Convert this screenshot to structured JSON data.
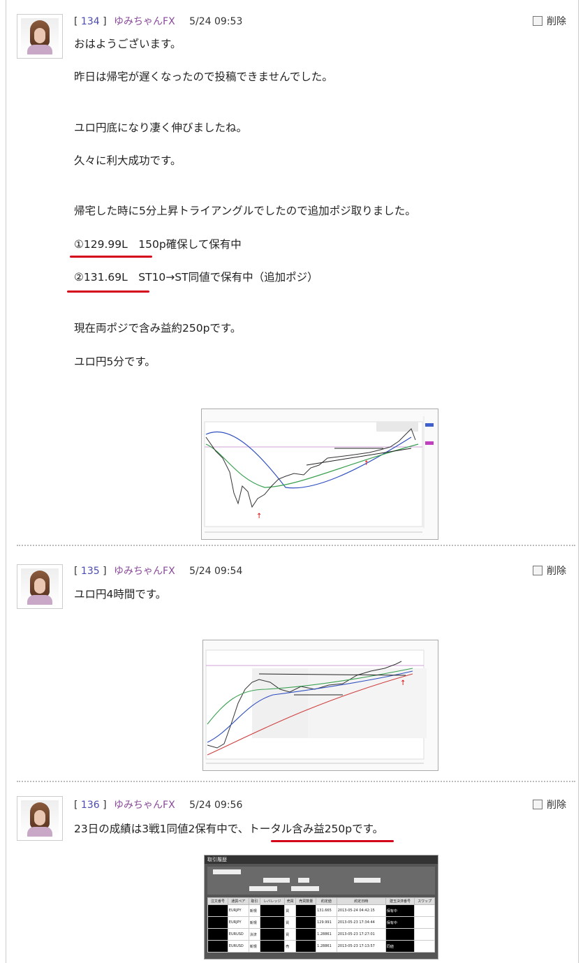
{
  "posts": [
    {
      "number": "134",
      "user": "ゆみちゃんFX",
      "date": "5/24 09:53",
      "delete_label": "削除",
      "lines": [
        "おはようございます。",
        "昨日は帰宅が遅くなったので投稿できませんでした。",
        "ユロ円底になり凄く伸びましたね。",
        "久々に利大成功です。",
        "帰宅した時に5分上昇トライアングルでしたので追加ポジ取りました。",
        "①129.99L　150p確保して保有中",
        "②131.69L　ST10→ST同値で保有中（追加ポジ）",
        "現在両ポジで含み益約250pです。",
        "ユロ円5分です。"
      ]
    },
    {
      "number": "135",
      "user": "ゆみちゃんFX",
      "date": "5/24 09:54",
      "delete_label": "削除",
      "lines": [
        "ユロ円4時間です。"
      ]
    },
    {
      "number": "136",
      "user": "ゆみちゃんFX",
      "date": "5/24 09:56",
      "delete_label": "削除",
      "lines": [
        "23日の成績は3戦1同値2保有中で、トータル含み益250pです。"
      ]
    }
  ],
  "history_table": {
    "title": "取引履歴",
    "headers": [
      "注文番号",
      "通貨ペア",
      "取引",
      "レバレッジ",
      "売買",
      "売買数量",
      "約定値",
      "約定日時",
      "建玉決済番号",
      "スワップ"
    ],
    "rows": [
      [
        "",
        "EURJPY",
        "新規",
        "",
        "買",
        "",
        "131.665",
        "2013-05-24 04:42:15",
        "保有中",
        ""
      ],
      [
        "",
        "EURJPY",
        "新規",
        "",
        "買",
        "",
        "129.991",
        "2013-05-23 17:34:44",
        "保有中",
        ""
      ],
      [
        "",
        "EURUSD",
        "決済",
        "",
        "買",
        "",
        "1.28861",
        "2013-05-23 17:27:01",
        "",
        ""
      ],
      [
        "",
        "EURUSD",
        "新規",
        "",
        "売",
        "",
        "1.28861",
        "2013-05-23 17:13:57",
        "同値",
        ""
      ]
    ]
  },
  "colors": {
    "underline": "#d4001a",
    "number": "#4a4ab0",
    "username": "#8a4a9a"
  }
}
